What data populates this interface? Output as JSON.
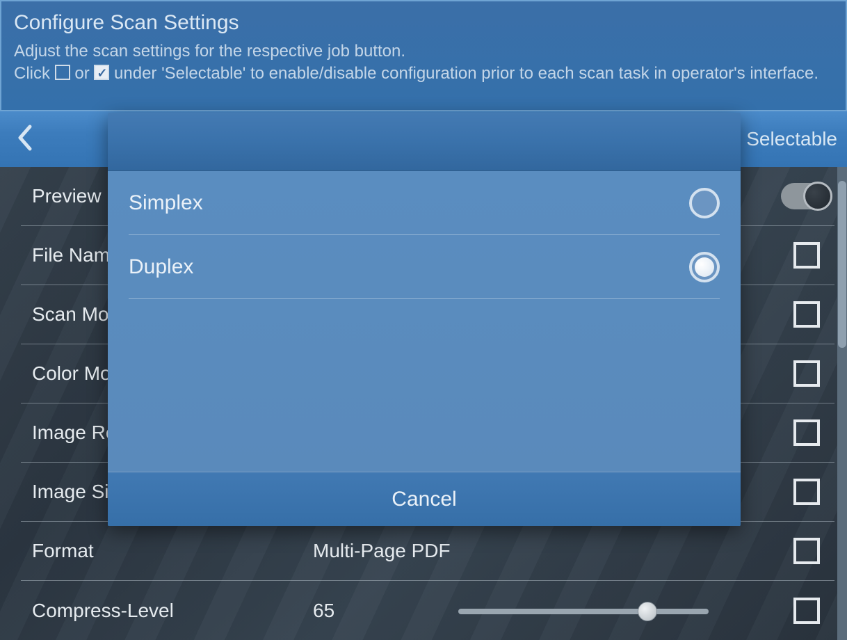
{
  "header": {
    "title": "Configure Scan Settings",
    "line1": "Adjust the scan settings for the respective job button.",
    "line2_pre": "Click ",
    "line2_mid": " or ",
    "line2_post": " under 'Selectable' to enable/disable configuration prior to each scan task in operator's interface."
  },
  "subheader": {
    "selectable": "Selectable"
  },
  "rows": {
    "preview": {
      "label": "Preview"
    },
    "file_name": {
      "label": "File Name"
    },
    "scan_mode": {
      "label": "Scan Mode"
    },
    "color_mode": {
      "label": "Color Mode"
    },
    "image_res": {
      "label": "Image Resolution"
    },
    "image_size": {
      "label": "Image Size"
    },
    "format": {
      "label": "Format",
      "value": "Multi-Page PDF"
    },
    "compress": {
      "label": "Compress-Level",
      "value": "65"
    }
  },
  "modal": {
    "options": {
      "simplex": "Simplex",
      "duplex": "Duplex"
    },
    "cancel": "Cancel"
  }
}
